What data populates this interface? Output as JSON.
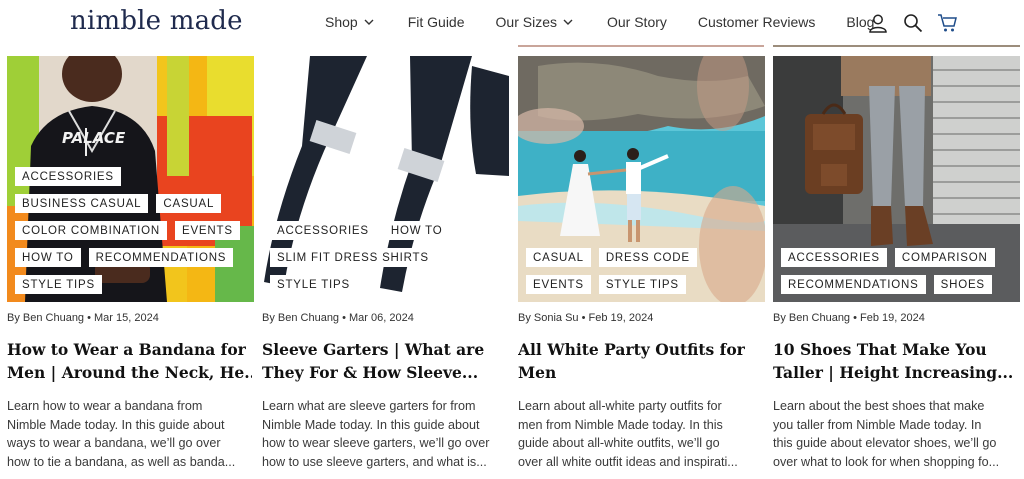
{
  "header": {
    "logo": "nimble made",
    "nav": [
      {
        "label": "Shop",
        "dropdown": true
      },
      {
        "label": "Fit Guide",
        "dropdown": false
      },
      {
        "label": "Our Sizes",
        "dropdown": true
      },
      {
        "label": "Our Story",
        "dropdown": false
      },
      {
        "label": "Customer Reviews",
        "dropdown": false
      },
      {
        "label": "Blog",
        "dropdown": false
      }
    ],
    "icons": [
      "account-icon",
      "search-icon",
      "cart-icon"
    ]
  },
  "colors": {
    "brand_navy": "#1f2a4d",
    "tag_bg": "#ffffff"
  },
  "posts": [
    {
      "tags": [
        "ACCESSORIES",
        "BUSINESS CASUAL",
        "CASUAL",
        "COLOR COMBINATION",
        "EVENTS",
        "HOW TO",
        "RECOMMENDATIONS",
        "STYLE TIPS"
      ],
      "meta": "By Ben Chuang • Mar 15, 2024",
      "title_lines": [
        "How to Wear a Bandana for",
        "Men | Around the Neck, He..."
      ],
      "excerpt_lines": [
        "Learn how to wear a bandana from",
        "Nimble Made today. In this guide about",
        "ways to wear a bandana, we’ll go over",
        "how to tie a bandana, as well as banda..."
      ]
    },
    {
      "tags": [
        "ACCESSORIES",
        "HOW TO",
        "SLIM FIT DRESS SHIRTS",
        "STYLE TIPS"
      ],
      "meta": "By Ben Chuang • Mar 06, 2024",
      "title_lines": [
        "Sleeve Garters | What are",
        "They For & How Sleeve..."
      ],
      "excerpt_lines": [
        "Learn what are sleeve garters for from",
        "Nimble Made today. In this guide about",
        "how to wear sleeve garters, we’ll go over",
        "how to use sleeve garters, and what is..."
      ]
    },
    {
      "tags": [
        "CASUAL",
        "DRESS CODE",
        "EVENTS",
        "STYLE TIPS"
      ],
      "meta": "By Sonia Su • Feb 19, 2024",
      "title_lines": [
        "All White Party Outfits for",
        "Men"
      ],
      "excerpt_lines": [
        "Learn about all-white party outfits for",
        "men from Nimble Made today. In this",
        "guide about all-white outfits, we’ll go",
        "over all white outfit ideas and inspirati..."
      ]
    },
    {
      "tags": [
        "ACCESSORIES",
        "COMPARISON",
        "RECOMMENDATIONS",
        "SHOES"
      ],
      "meta": "By Ben Chuang • Feb 19, 2024",
      "title_lines": [
        "10 Shoes That Make You",
        "Taller | Height Increasing..."
      ],
      "excerpt_lines": [
        "Learn about the best shoes that make",
        "you taller from Nimble Made today. In",
        "this guide about elevator shoes, we’ll go",
        "over what to look for when shopping fo..."
      ]
    }
  ]
}
